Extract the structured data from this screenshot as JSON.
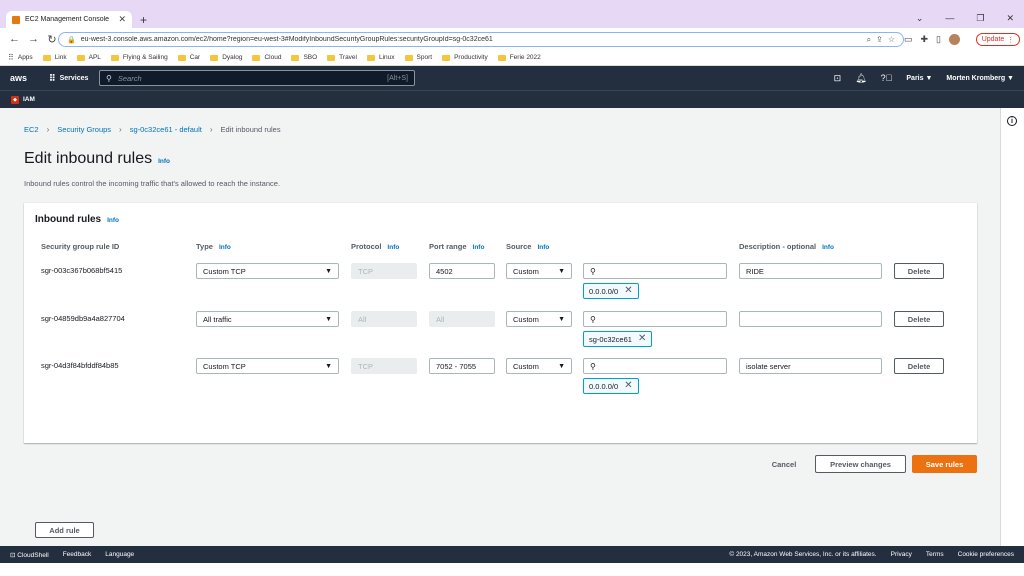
{
  "browser": {
    "tab_title": "EC2 Management Console",
    "url": "eu-west-3.console.aws.amazon.com/ec2/home?region=eu-west-3#ModifyInboundSecurityGroupRules:securityGroupId=sg-0c32ce61",
    "update_label": "Update",
    "bookmarks": [
      "Apps",
      "Link",
      "APL",
      "Flying & Sailing",
      "Car",
      "Dyalog",
      "Cloud",
      "SBO",
      "Travel",
      "Linux",
      "Sport",
      "Productivity",
      "Ferie 2022"
    ]
  },
  "aws_nav": {
    "logo": "aws",
    "services": "Services",
    "search_placeholder": "Search",
    "search_shortcut": "[Alt+S]",
    "region": "Paris ▼",
    "user": "Morten Kromberg ▼",
    "service_label": "IAM"
  },
  "breadcrumbs": [
    "EC2",
    "Security Groups",
    "sg-0c32ce61 - default",
    "Edit inbound rules"
  ],
  "page": {
    "title": "Edit inbound rules",
    "info": "Info",
    "description": "Inbound rules control the incoming traffic that's allowed to reach the instance."
  },
  "panel": {
    "title": "Inbound rules",
    "info": "Info",
    "columns": {
      "rule_id": "Security group rule ID",
      "type": "Type",
      "protocol": "Protocol",
      "port_range": "Port range",
      "source": "Source",
      "description": "Description - optional"
    },
    "rules": [
      {
        "id": "sgr-003c367b068bf5415",
        "type": "Custom TCP",
        "protocol": "TCP",
        "port": "4502",
        "source": "Custom",
        "token": "0.0.0.0/0",
        "description": "RIDE"
      },
      {
        "id": "sgr-04859db9a4a827704",
        "type": "All traffic",
        "protocol": "All",
        "port": "All",
        "source": "Custom",
        "token": "sg-0c32ce61",
        "description": ""
      },
      {
        "id": "sgr-04d3f84bfddf84b85",
        "type": "Custom TCP",
        "protocol": "TCP",
        "port": "7052 - 7055",
        "source": "Custom",
        "token": "0.0.0.0/0",
        "description": "isolate server"
      }
    ],
    "delete_label": "Delete",
    "add_rule_label": "Add rule"
  },
  "actions": {
    "cancel": "Cancel",
    "preview": "Preview changes",
    "save": "Save rules"
  },
  "footer": {
    "cloudshell": "CloudShell",
    "feedback": "Feedback",
    "language": "Language",
    "copyright": "© 2023, Amazon Web Services, Inc. or its affiliates.",
    "privacy": "Privacy",
    "terms": "Terms",
    "cookies": "Cookie preferences"
  },
  "colors": {
    "aws_nav": "#232f3e",
    "link": "#0073bb",
    "primary": "#ec7211",
    "token_border": "#00a1c9"
  }
}
